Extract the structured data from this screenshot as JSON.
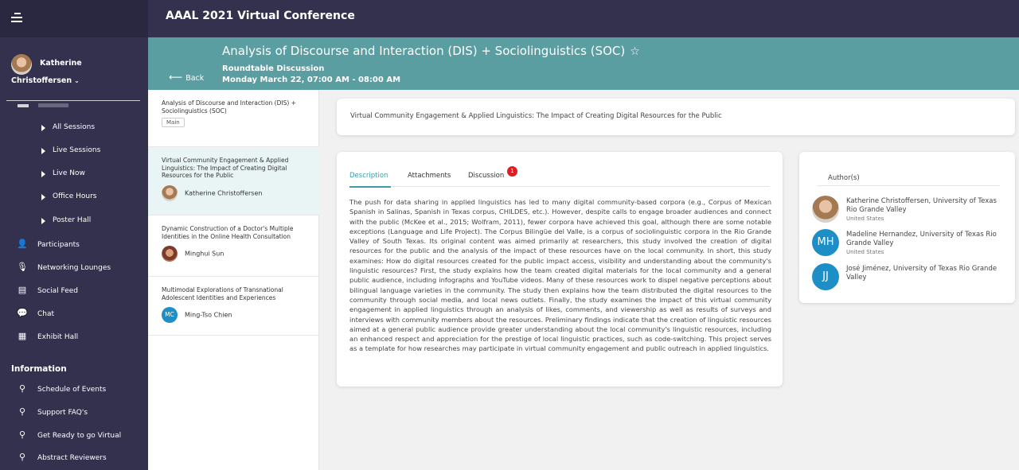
{
  "app": {
    "title": "AAAL 2021 Virtual Conference"
  },
  "user": {
    "first_name": "Katherine",
    "last_name": "Christoffersen"
  },
  "sidebar": {
    "program_items": [
      "All Sessions",
      "Live Sessions",
      "Live Now",
      "Office Hours",
      "Poster Hall"
    ],
    "main_items": [
      {
        "label": "Participants",
        "icon": "person-icon"
      },
      {
        "label": "Networking Lounges",
        "icon": "microphone-icon"
      },
      {
        "label": "Social Feed",
        "icon": "feed-icon"
      },
      {
        "label": "Chat",
        "icon": "chat-icon"
      },
      {
        "label": "Exhibit Hall",
        "icon": "building-icon"
      }
    ],
    "information_title": "Information",
    "information_items": [
      {
        "label": "Schedule of Events",
        "icon": "pin-icon"
      },
      {
        "label": "Support FAQ's",
        "icon": "pin-icon"
      },
      {
        "label": "Get Ready to go Virtual",
        "icon": "pin-icon"
      },
      {
        "label": "Abstract Reviewers",
        "icon": "pin-icon"
      }
    ]
  },
  "session": {
    "back_label": "Back",
    "title": "Analysis of Discourse and Interaction (DIS) + Sociolinguistics (SOC)",
    "type": "Roundtable Discussion",
    "time": "Monday March 22, 07:00 AM - 08:00 AM"
  },
  "presentations": [
    {
      "title": "Analysis of Discourse and Interaction (DIS) + Sociolinguistics (SOC)",
      "tag": "Main"
    },
    {
      "title": "Virtual Community Engagement & Applied Linguistics: The Impact of Creating Digital Resources for the Public",
      "author": "Katherine Christoffersen"
    },
    {
      "title": "Dynamic Construction of a Doctor's Multiple Identities in the Online Health Consultation",
      "author": "Minghui Sun"
    },
    {
      "title": "Multimodal Explorations of Transnational Adolescent Identities and Experiences",
      "author": "Ming-Tso Chien",
      "initials": "MC"
    }
  ],
  "detail": {
    "title": "Virtual Community Engagement & Applied Linguistics: The Impact of Creating Digital Resources for the Public",
    "tabs": [
      "Description",
      "Attachments",
      "Discussion"
    ],
    "discussion_count": "1",
    "description": "The push for data sharing in applied linguistics has led to many digital community-based corpora (e.g., Corpus of Mexican Spanish in Salinas, Spanish in Texas corpus, CHILDES, etc.). However, despite calls to engage broader audiences and connect with the public (McKee et al., 2015; Wolfram, 2011), fewer corpora have achieved this goal, although there are some notable exceptions (Language and Life Project). The Corpus Bilingüe del Valle, is a corpus of sociolinguistic corpora in the Rio Grande Valley of South Texas. Its original content was aimed primarily at researchers, this study involved the creation of digital resources for the public and the analysis of the impact of these resources have on the local community. In short, this study examines: How do digital resources created for the public impact access, visibility and understanding about the community's linguistic resources? First, the study explains how the team created digital materials for the local community and a general public audience, including infographs and YouTube videos. Many of these resources work to dispel negative perceptions about bilingual language varieties in the community. The study then explains how the team distributed the digital resources to the community through social media, and local news outlets. Finally, the study examines the impact of this virtual community engagement in applied linguistics through an analysis of likes, comments, and viewership as well as results of surveys and interviews with community members about the resources. Preliminary findings indicate that the creation of linguistic resources aimed at a general public audience provide greater understanding about the local community's linguistic resources, including an enhanced respect and appreciation for the prestige of local linguistic practices, such as code-switching. This project serves as a template for how researches may participate in virtual community engagement and public outreach in applied linguistics."
  },
  "authors": {
    "heading": "Author(s)",
    "list": [
      {
        "name": "Katherine Christoffersen, University of Texas Rio Grande Valley",
        "country": "United States"
      },
      {
        "name": "Madeline Hernandez, University of Texas Rio Grande Valley",
        "country": "United States",
        "initials": "MH"
      },
      {
        "name": "José Jiménez, University of Texas Rio Grande Valley",
        "initials": "JJ"
      }
    ]
  },
  "colors": {
    "sidebar": "#34314e",
    "banner": "#5a9ea1",
    "accent": "#3f9aa5",
    "badge": "#e31b23",
    "initials_avatar": "#1e8ec7"
  }
}
